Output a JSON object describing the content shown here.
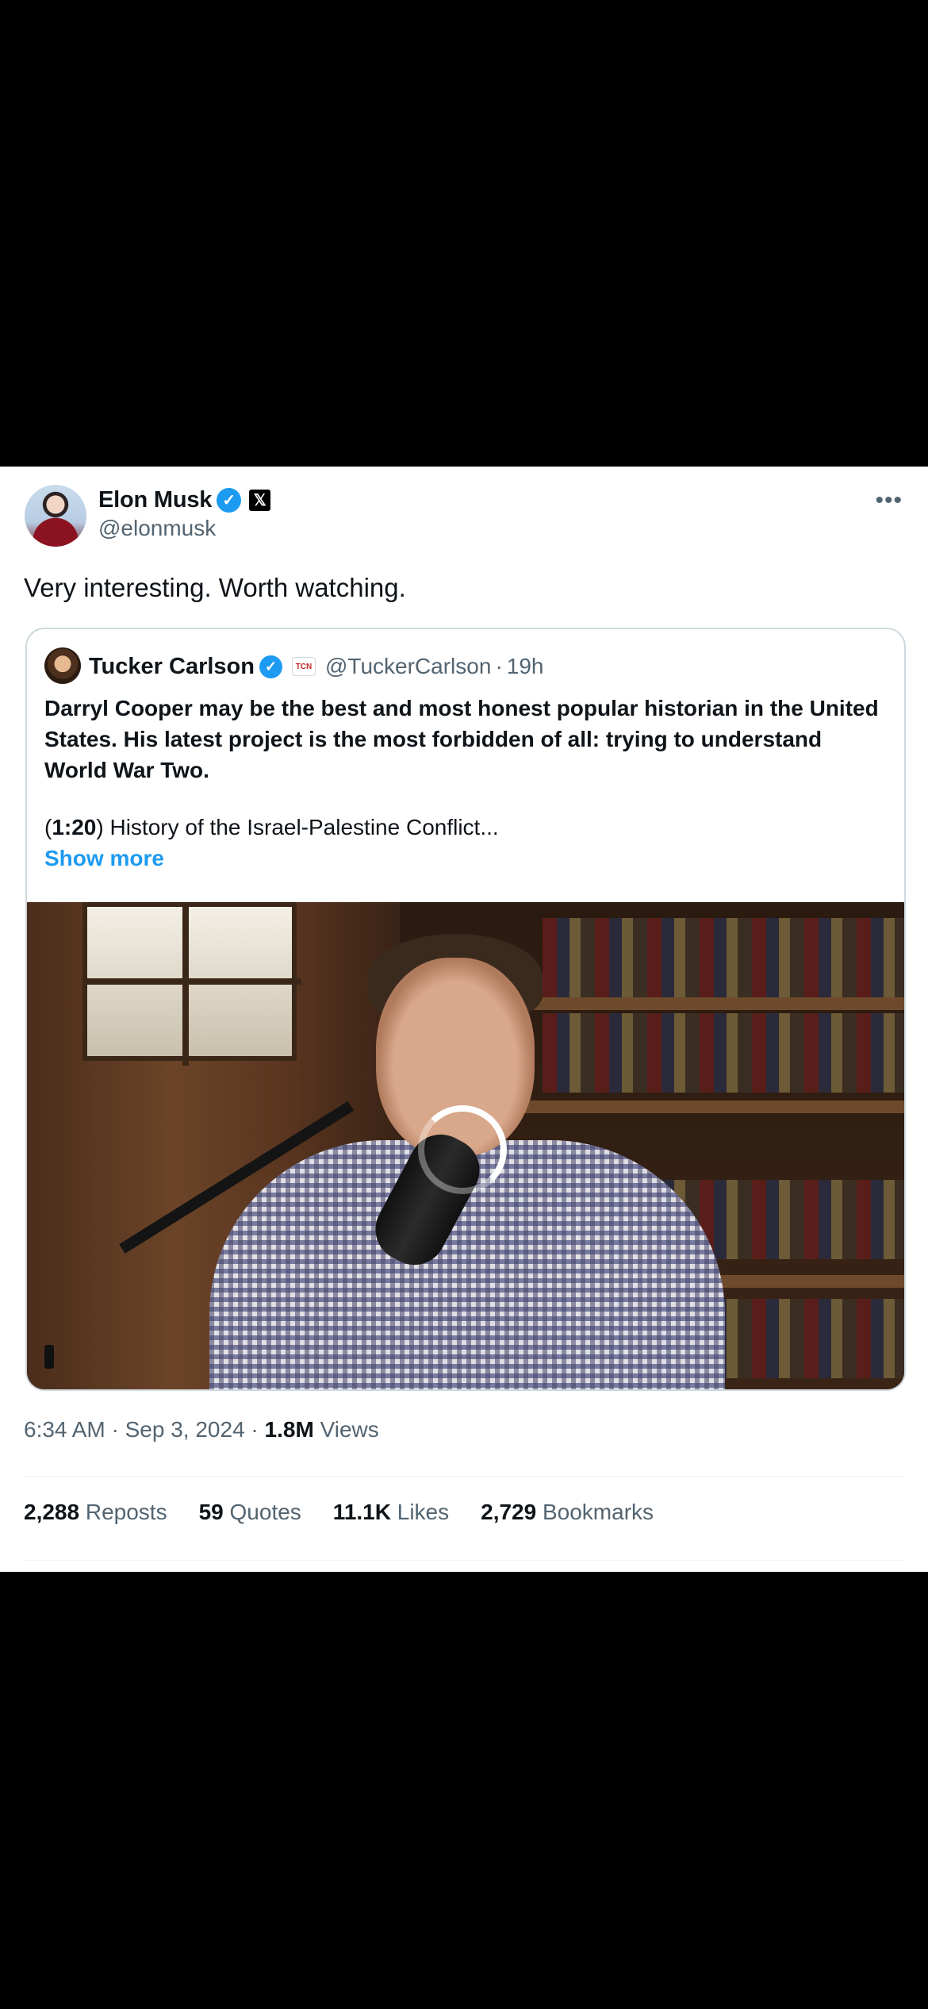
{
  "post": {
    "author_name": "Elon Musk",
    "author_handle": "@elonmusk",
    "more_icon": "more-horizontal-icon",
    "text": "Very interesting. Worth watching."
  },
  "quote": {
    "author_name": "Tucker Carlson",
    "author_handle": "@TuckerCarlson",
    "separator": "·",
    "time": "19h",
    "body": "Darryl Cooper may be the best and most honest popular historian in the United States. His latest project is the most forbidden of all: trying to understand World War Two.",
    "timestamp_label": "1:20",
    "line2_text": " History of the Israel-Palestine Conflict...",
    "show_more": "Show more"
  },
  "meta": {
    "time": "6:34 AM",
    "sep1": " · ",
    "date": "Sep 3, 2024",
    "sep2": " · ",
    "views_count": "1.8M",
    "views_label": " Views"
  },
  "stats": {
    "reposts_count": "2,288",
    "reposts_label": " Reposts",
    "quotes_count": "59",
    "quotes_label": " Quotes",
    "likes_count": "11.1K",
    "likes_label": " Likes",
    "bookmarks_count": "2,729",
    "bookmarks_label": " Bookmarks"
  },
  "colors": {
    "accent": "#1d9bf0",
    "text_primary": "#0f1419",
    "text_secondary": "#536471",
    "background": "#000000"
  }
}
